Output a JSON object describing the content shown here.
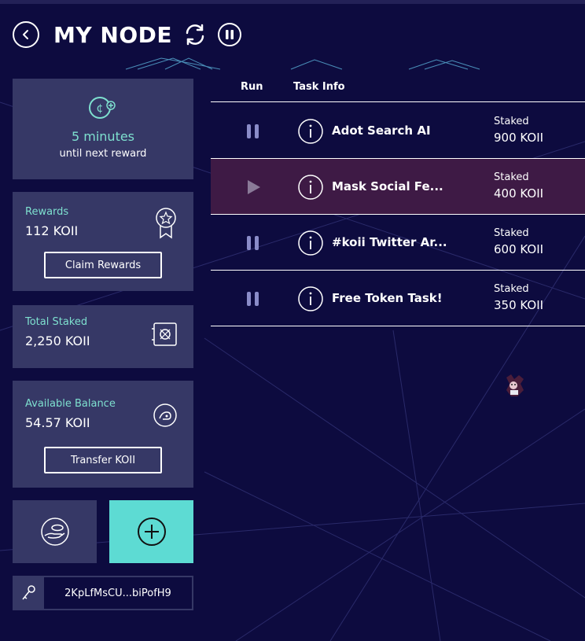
{
  "header": {
    "title": "MY NODE",
    "back_icon": "chevron-left-icon",
    "refresh_icon": "refresh-icon",
    "pause_icon": "pause-icon"
  },
  "reward_timer": {
    "icon": "coin-timer-icon",
    "time": "5 minutes",
    "subtitle": "until next reward"
  },
  "rewards": {
    "label": "Rewards",
    "value": "112 KOII",
    "icon": "award-ribbon-icon",
    "button_label": "Claim Rewards"
  },
  "total_staked": {
    "label": "Total Staked",
    "value": "2,250 KOII",
    "icon": "safe-icon"
  },
  "balance": {
    "label": "Available Balance",
    "value": "54.57 KOII",
    "icon": "wallet-icon",
    "button_label": "Transfer KOII"
  },
  "actions": {
    "left_icon": "hand-coin-icon",
    "right_icon": "add-circle-icon"
  },
  "key": {
    "icon": "key-icon",
    "address": "2KpLfMsCU...biPofH9"
  },
  "table": {
    "col_run": "Run",
    "col_info": "Task Info",
    "rows": [
      {
        "name": "Adot Search AI",
        "staked_label": "Staked",
        "staked": "900 KOII",
        "state": "running"
      },
      {
        "name": "Mask Social Fe...",
        "staked_label": "Staked",
        "staked": "400 KOII",
        "state": "paused"
      },
      {
        "name": "#koii Twitter Ar...",
        "staked_label": "Staked",
        "staked": "600 KOII",
        "state": "running"
      },
      {
        "name": "Free Token Task!",
        "staked_label": "Staked",
        "staked": "350 KOII",
        "state": "running"
      }
    ]
  },
  "colors": {
    "background": "#0d0b3f",
    "card": "#363866",
    "accent": "#7ee0cf",
    "add_button": "#5ddbd3",
    "active_row": "#3e1a45"
  }
}
